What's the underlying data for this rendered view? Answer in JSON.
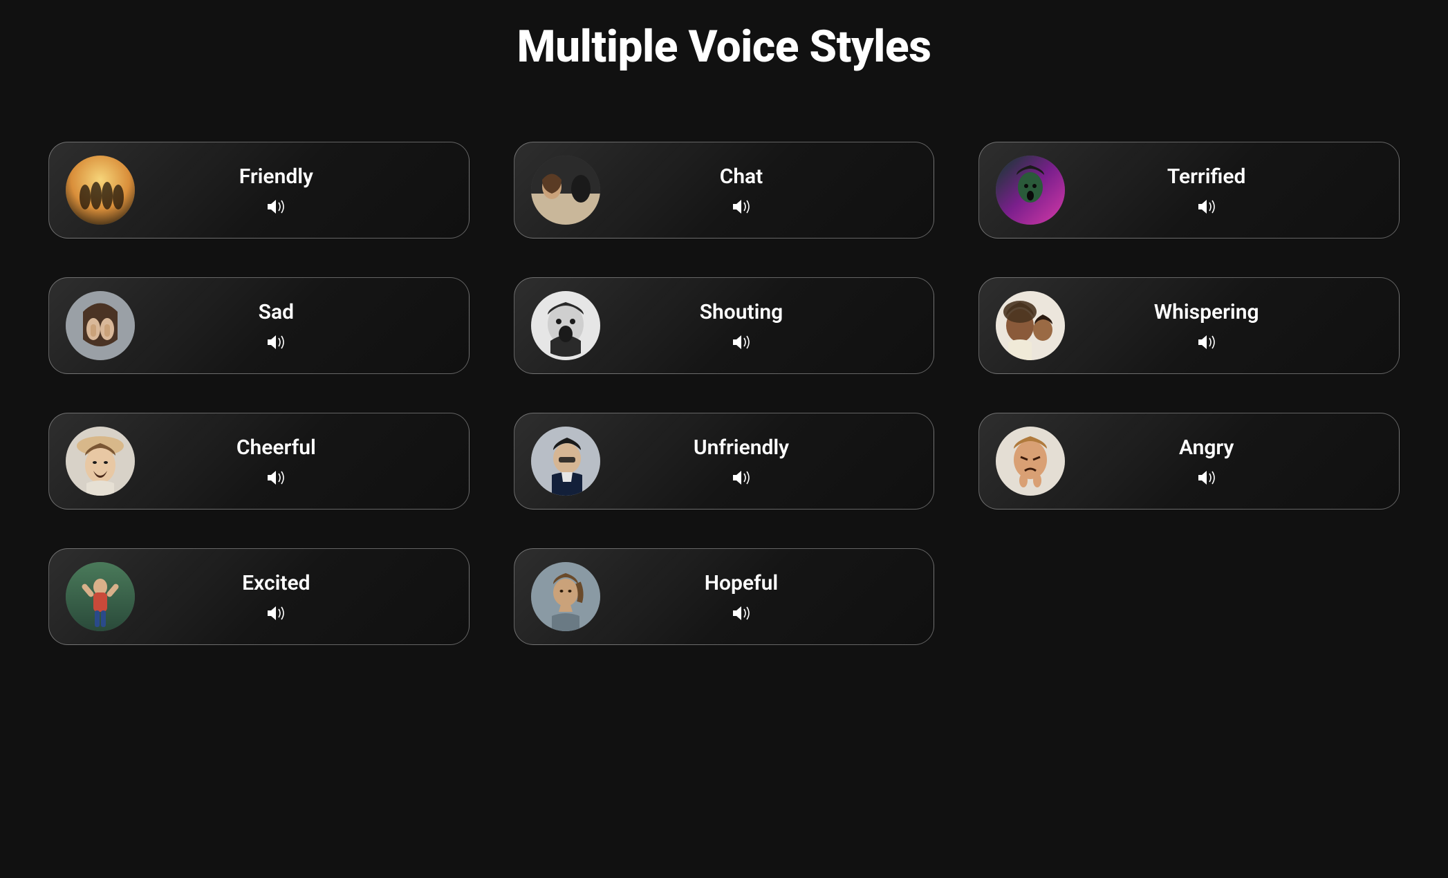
{
  "title": "Multiple Voice Styles",
  "styles": [
    {
      "label": "Friendly",
      "icon": "speaker-icon",
      "avatar": "friendly-avatar"
    },
    {
      "label": "Chat",
      "icon": "speaker-icon",
      "avatar": "chat-avatar"
    },
    {
      "label": "Terrified",
      "icon": "speaker-icon",
      "avatar": "terrified-avatar"
    },
    {
      "label": "Sad",
      "icon": "speaker-icon",
      "avatar": "sad-avatar"
    },
    {
      "label": "Shouting",
      "icon": "speaker-icon",
      "avatar": "shouting-avatar"
    },
    {
      "label": "Whispering",
      "icon": "speaker-icon",
      "avatar": "whispering-avatar"
    },
    {
      "label": "Cheerful",
      "icon": "speaker-icon",
      "avatar": "cheerful-avatar"
    },
    {
      "label": "Unfriendly",
      "icon": "speaker-icon",
      "avatar": "unfriendly-avatar"
    },
    {
      "label": "Angry",
      "icon": "speaker-icon",
      "avatar": "angry-avatar"
    },
    {
      "label": "Excited",
      "icon": "speaker-icon",
      "avatar": "excited-avatar"
    },
    {
      "label": "Hopeful",
      "icon": "speaker-icon",
      "avatar": "hopeful-avatar"
    }
  ]
}
